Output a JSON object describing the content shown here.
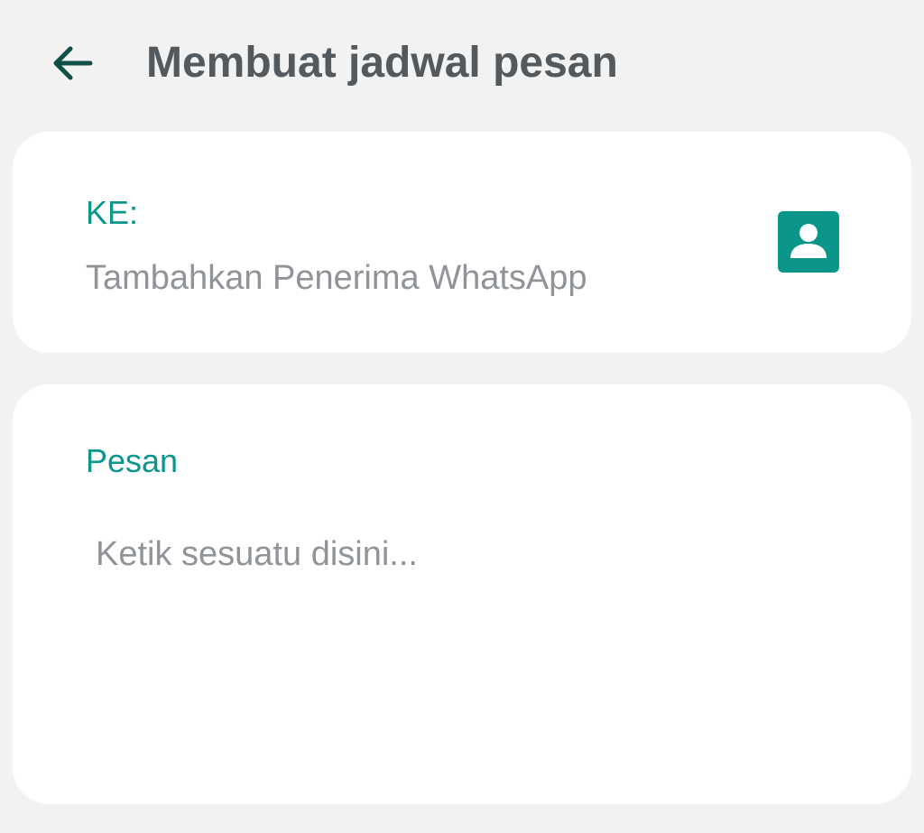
{
  "header": {
    "title": "Membuat jadwal pesan",
    "back_icon": "arrow-left-icon"
  },
  "recipient": {
    "label": "KE:",
    "placeholder": "Tambahkan Penerima WhatsApp",
    "contact_icon": "contact-person-icon"
  },
  "message": {
    "label": "Pesan",
    "placeholder": "Ketik sesuatu disini..."
  },
  "colors": {
    "background": "#f2f2f2",
    "card": "#ffffff",
    "accent": "#0a968a",
    "title_text": "#54595d",
    "placeholder_text": "#909498",
    "back_arrow": "#0f4f46"
  }
}
